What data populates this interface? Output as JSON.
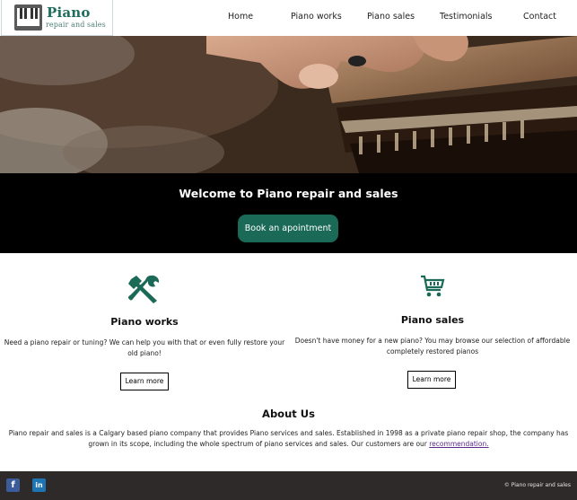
{
  "brand": {
    "title": "Piano",
    "subtitle": "repair and sales",
    "accent_color": "#1e6e5e"
  },
  "nav": {
    "items": [
      {
        "label": "Home"
      },
      {
        "label": "Piano works"
      },
      {
        "label": "Piano sales"
      },
      {
        "label": "Testimonials"
      },
      {
        "label": "Contact"
      }
    ]
  },
  "hero": {
    "image": "hands-tuning-piano-action-photo"
  },
  "welcome": {
    "title": "Welcome to Piano repair and sales",
    "button_label": "Book an apointment",
    "button_color": "#1b6a58"
  },
  "features": [
    {
      "icon": "tools-icon",
      "title": "Piano works",
      "text": "Need a piano repair or tuning? We can help you with that or even fully restore your old piano!",
      "button_label": "Learn more"
    },
    {
      "icon": "shopping-cart-icon",
      "title": "Piano sales",
      "text": "Doesn't have money for a new piano? You may browse our selection of affordable completely restored pianos",
      "button_label": "Learn more"
    }
  ],
  "about": {
    "title": "About Us",
    "text": "Piano repair and sales is a Calgary based piano company that provides Piano services and sales. Established in 1998 as a private piano repair shop, the company has grown in its scope, including the whole spectrum of piano services and sales. Our customers are our ",
    "link_label": "recommendation."
  },
  "footer": {
    "social": [
      {
        "icon": "facebook-icon",
        "glyph": "f"
      },
      {
        "icon": "linkedin-icon",
        "glyph": "in"
      }
    ],
    "copyright": "© Piano repair and sales",
    "background": "#2e2a29"
  }
}
